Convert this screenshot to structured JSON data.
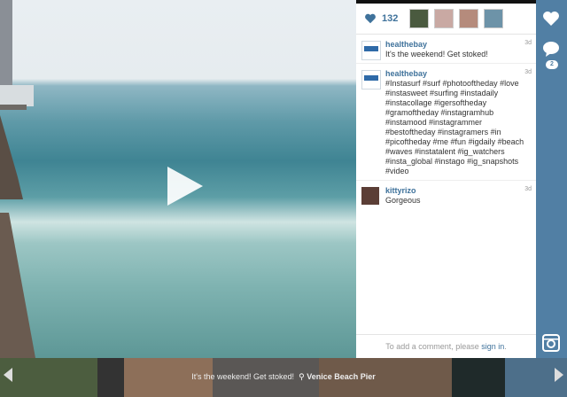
{
  "post": {
    "likes_count": "132",
    "comments": [
      {
        "user": "healthebay",
        "text": "It's the weekend! Get stoked!",
        "time": "3d"
      },
      {
        "user": "healthebay",
        "text": "#Instasurf #surf #photooftheday #love #instasweet #surfing #instadaily #instacollage #igersoftheday #gramoftheday #instagramhub #instamood #instagrammer #bestoftheday #instagramers #in #picoftheday #me #fun #igdaily #beach #waves #instatalent #ig_watchers #insta_global #instago #ig_snapshots #video",
        "time": "3d"
      },
      {
        "user": "kittyrizo",
        "text": "Gorgeous",
        "time": "3d"
      }
    ],
    "signin_prefix": "To add a comment, please ",
    "signin_link": "sign in",
    "signin_suffix": "."
  },
  "sidebar": {
    "comment_badge": "2"
  },
  "strip": {
    "caption": "It's the weekend! Get stoked!",
    "location": "Venice Beach Pier"
  },
  "colors": {
    "accent": "#3f729b",
    "sidebar": "#517fa4"
  }
}
